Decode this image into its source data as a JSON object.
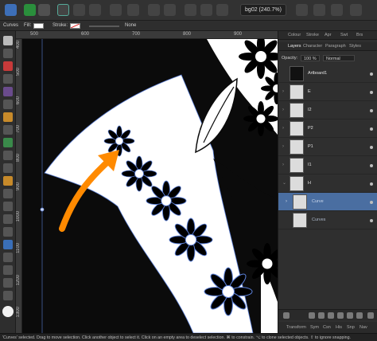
{
  "toolbar": {
    "document_title": "bg02 (240.7%)",
    "icons": [
      "app-menu-icon",
      "persona-icon",
      "persona-icon",
      "color-wheel-icon",
      "gear-icon",
      "gear-icon",
      "grid-icon",
      "snapping-icon",
      "order-icon",
      "transform-icon",
      "boolean-icon",
      "align-icon",
      "align-icon"
    ]
  },
  "context": {
    "tool_label": "Curves",
    "fill_label": "Fill:",
    "stroke_label": "Stroke:",
    "stroke_value": "None"
  },
  "rulers": {
    "h_ticks": [
      "500",
      "600",
      "700",
      "800",
      "900"
    ],
    "v_ticks": [
      "400",
      "500",
      "600",
      "700",
      "800",
      "900",
      "1000",
      "1100",
      "1200",
      "1300"
    ]
  },
  "panel": {
    "top_tabs": [
      "Colour",
      "Stroke",
      "Apr",
      "Swt",
      "Brs"
    ],
    "layer_tabs": [
      "Layers",
      "Character",
      "Paragraph",
      "Styles"
    ],
    "opacity_label": "Opacity:",
    "opacity_value": "100 %",
    "blend_mode": "Normal",
    "layers": [
      {
        "name": "Artboard1",
        "selected": false
      },
      {
        "name": "E",
        "selected": false
      },
      {
        "name": "I2",
        "selected": false
      },
      {
        "name": "P2",
        "selected": false
      },
      {
        "name": "P1",
        "selected": false
      },
      {
        "name": "I1",
        "selected": false
      },
      {
        "name": "H",
        "selected": false
      },
      {
        "name": "Curve",
        "selected": true
      },
      {
        "name": "Curves",
        "selected": false
      }
    ],
    "bottom_tabs": [
      "Transform",
      "Sym",
      "Csn",
      "His",
      "Snp",
      "Nav"
    ]
  },
  "status": {
    "text": "'Curves' selected. Drag to move selection. Click another object to select it. Click on an empty area to deselect selection. ⌘ to constrain. ⌥ to clone selected objects. ⇧ to ignore snapping."
  },
  "colors": {
    "arrow": "#ff8a00",
    "selection": "#4a6ea1",
    "canvas": "#0b0b0b"
  }
}
